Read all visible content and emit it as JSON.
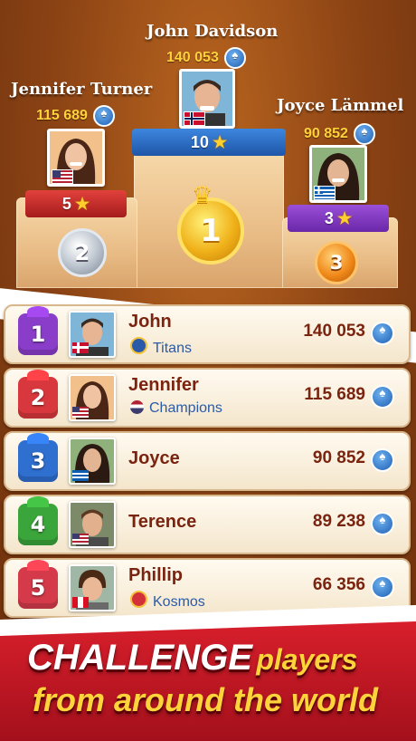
{
  "podium": {
    "first": {
      "name": "John Davidson",
      "score": "140 053",
      "level": "10",
      "country": "Norway"
    },
    "second": {
      "name": "Jennifer Turner",
      "score": "115 689",
      "level": "5",
      "country": "USA"
    },
    "third": {
      "name": "Joyce Lämmel",
      "score": "90 852",
      "level": "3",
      "country": "Greece"
    },
    "medals": {
      "gold": "1",
      "silver": "2",
      "bronze": "3"
    }
  },
  "leaderboard": [
    {
      "rank": "1",
      "name": "John",
      "team": "Titans",
      "score": "140 053",
      "gift_color": "#8a3dc9",
      "country": "Norway"
    },
    {
      "rank": "2",
      "name": "Jennifer",
      "team": "Champions",
      "score": "115 689",
      "gift_color": "#d8383d",
      "country": "USA"
    },
    {
      "rank": "3",
      "name": "Joyce",
      "team": "",
      "score": "90 852",
      "gift_color": "#2f6fd0",
      "country": "Greece"
    },
    {
      "rank": "4",
      "name": "Terence",
      "team": "",
      "score": "89 238",
      "gift_color": "#3aa53a",
      "country": "USA"
    },
    {
      "rank": "5",
      "name": "Phillip",
      "team": "Kosmos",
      "score": "66 356",
      "gift_color": "#d43a4a",
      "country": "Peru"
    }
  ],
  "banner": {
    "word1": "CHALLENGE",
    "word2": "players",
    "line2": "from around the world"
  },
  "colors": {
    "accent_red": "#d81f2c",
    "accent_gold": "#ffd43a",
    "brown": "#8a4214"
  },
  "icons": {
    "coin": "spade-coin-icon",
    "star": "star-icon"
  }
}
